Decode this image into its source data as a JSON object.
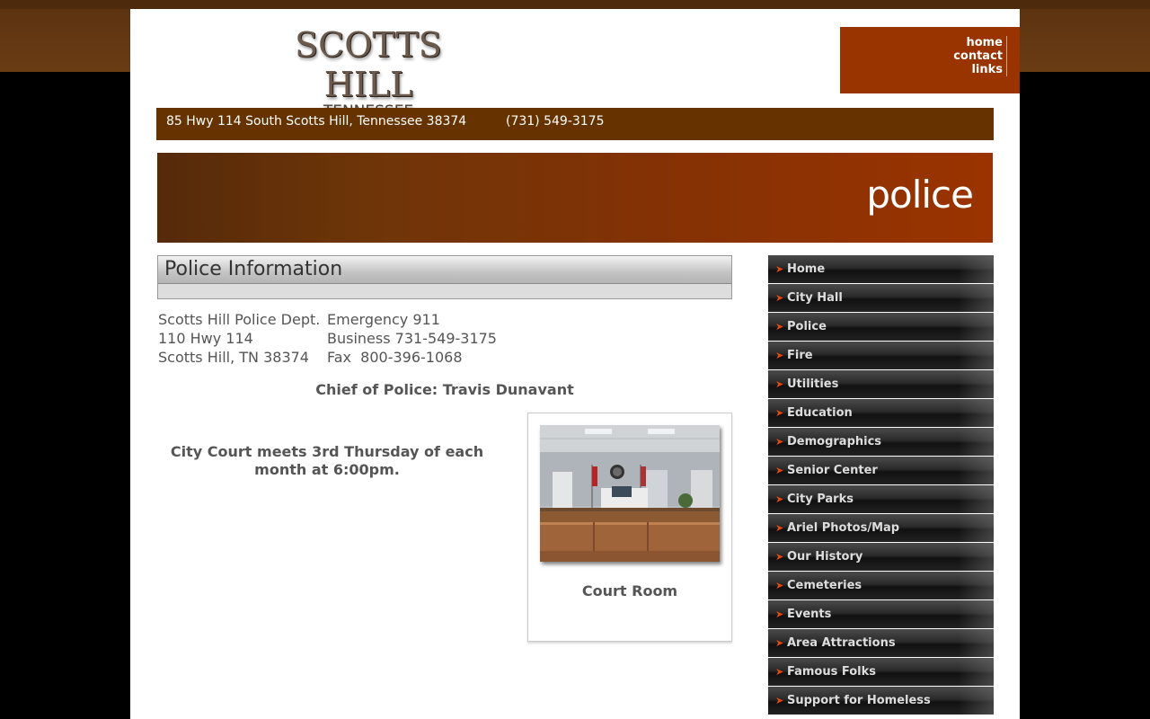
{
  "site": {
    "logo_title": "SCOTTS HILL",
    "logo_subtitle": "TENNESSEE"
  },
  "topnav": {
    "items": [
      "home",
      "contact",
      "links"
    ]
  },
  "address_bar": {
    "street": "85 Hwy 114 South Scotts Hill, Tennessee 38374",
    "phone": "(731) 549-3175"
  },
  "banner": {
    "title": "police"
  },
  "content": {
    "heading": "Police Information",
    "contact_left": [
      "Scotts Hill Police Dept.",
      "110 Hwy 114",
      "Scotts Hill, TN 38374"
    ],
    "contact_right": [
      "Emergency 911",
      "Business 731-549-3175",
      "Fax  800-396-1068"
    ],
    "chief": "Chief of Police: Travis Dunavant",
    "court_notice_1": "City Court meets 3rd Thursday of each",
    "court_notice_2": "month at 6:00pm.",
    "photo_caption": "Court Room"
  },
  "sidenav": {
    "items": [
      "Home",
      "City Hall",
      "Police",
      "Fire",
      "Utilities",
      "Education",
      "Demographics",
      "Senior Center",
      "City Parks",
      "Ariel Photos/Map",
      "Our History",
      "Cemeteries",
      "Events",
      "Area Attractions",
      "Famous Folks",
      "Support for Homeless"
    ]
  },
  "colors": {
    "brand_brown": "#663300",
    "accent_rust": "#993300",
    "nav_dark": "#222222"
  }
}
